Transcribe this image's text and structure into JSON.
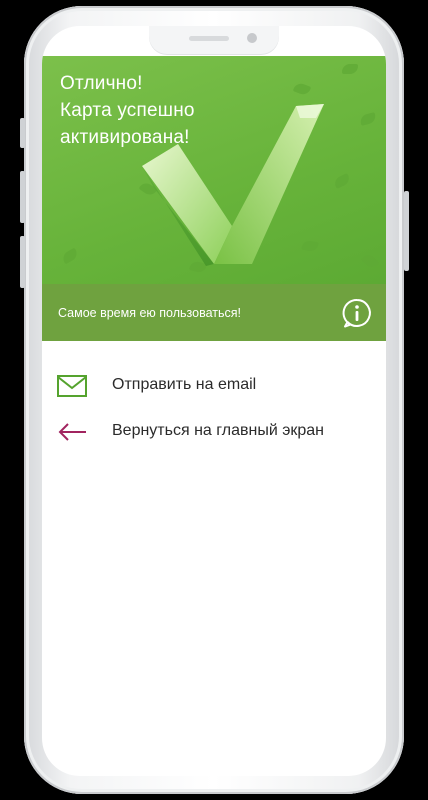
{
  "hero": {
    "title_lines": [
      "Отлично!",
      "Карта успешно",
      "активирована!"
    ],
    "subtitle": "Самое время ею пользоваться!"
  },
  "menu": {
    "items": [
      {
        "label": "Отправить на email",
        "icon": "mail-icon"
      },
      {
        "label": "Вернуться на главный экран",
        "icon": "arrow-left-icon"
      }
    ]
  },
  "colors": {
    "hero_green": "#6cb53c",
    "bar_green": "#6fa23f",
    "mail_icon": "#55a32e",
    "back_arrow": "#a1245f"
  }
}
